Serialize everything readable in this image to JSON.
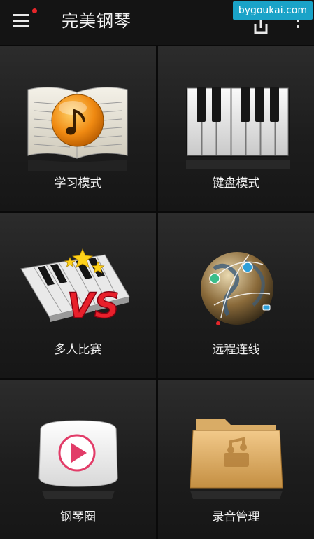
{
  "app": {
    "title": "完美钢琴"
  },
  "watermark": {
    "text": "bygoukai.com"
  },
  "header_icons": {
    "menu": "menu-icon",
    "share": "share-icon",
    "more": "more-vertical-icon",
    "notification_color": "#e5262a"
  },
  "tiles": [
    {
      "label": "学习模式",
      "icon": "music-book-icon"
    },
    {
      "label": "键盘模式",
      "icon": "piano-keys-icon"
    },
    {
      "label": "多人比赛",
      "icon": "vs-battle-icon"
    },
    {
      "label": "远程连线",
      "icon": "globe-network-icon"
    },
    {
      "label": "钢琴圈",
      "icon": "play-circle-icon"
    },
    {
      "label": "录音管理",
      "icon": "folder-icon"
    }
  ]
}
